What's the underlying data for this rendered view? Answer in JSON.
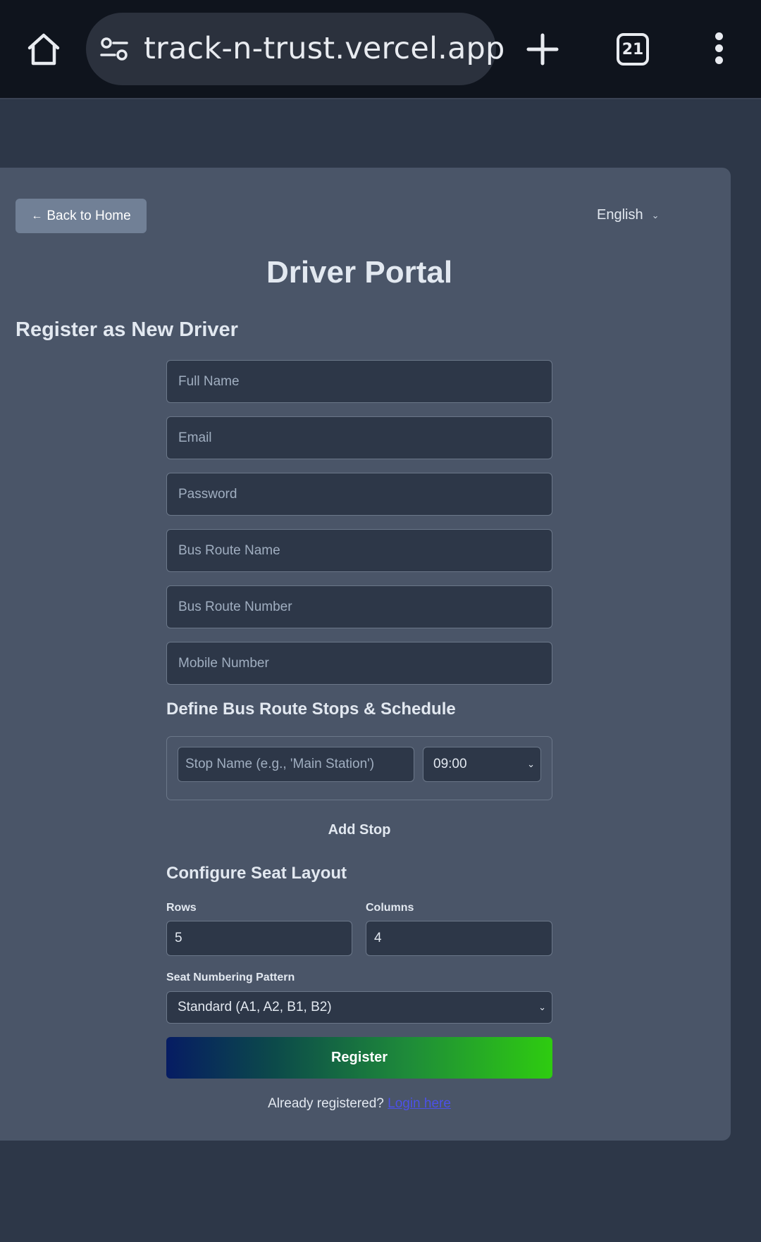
{
  "browser": {
    "url": "track-n-trust.vercel.app",
    "tab_count": "21",
    "icons": [
      "home-icon",
      "site-settings-icon",
      "new-tab-icon",
      "tabs-icon",
      "more-menu-icon"
    ]
  },
  "header": {
    "back_label": "Back to Home",
    "back_arrow": "←",
    "language": "English",
    "language_chevron": "⌄"
  },
  "page_title": "Driver Portal",
  "register_heading": "Register as New Driver",
  "form": {
    "full_name_placeholder": "Full Name",
    "email_placeholder": "Email",
    "password_placeholder": "Password",
    "route_name_placeholder": "Bus Route Name",
    "route_number_placeholder": "Bus Route Number",
    "mobile_placeholder": "Mobile Number"
  },
  "stops": {
    "heading": "Define Bus Route Stops & Schedule",
    "stop_name_placeholder": "Stop Name (e.g., 'Main Station')",
    "time_value": "09:00",
    "add_label": "Add Stop"
  },
  "seats": {
    "heading": "Configure Seat Layout",
    "rows_label": "Rows",
    "rows_value": "5",
    "columns_label": "Columns",
    "columns_value": "4",
    "pattern_label": "Seat Numbering Pattern",
    "pattern_value": "Standard (A1, A2, B1, B2)"
  },
  "register_label": "Register",
  "footer": {
    "already_text": "Already registered?",
    "login_link": "Login here"
  },
  "colors": {
    "background": "#2d3748",
    "card": "#4a5568",
    "input": "#2d3748",
    "link": "#4c51e8",
    "button_gradient_start": "#061c63",
    "button_gradient_end": "#2ecc10"
  }
}
